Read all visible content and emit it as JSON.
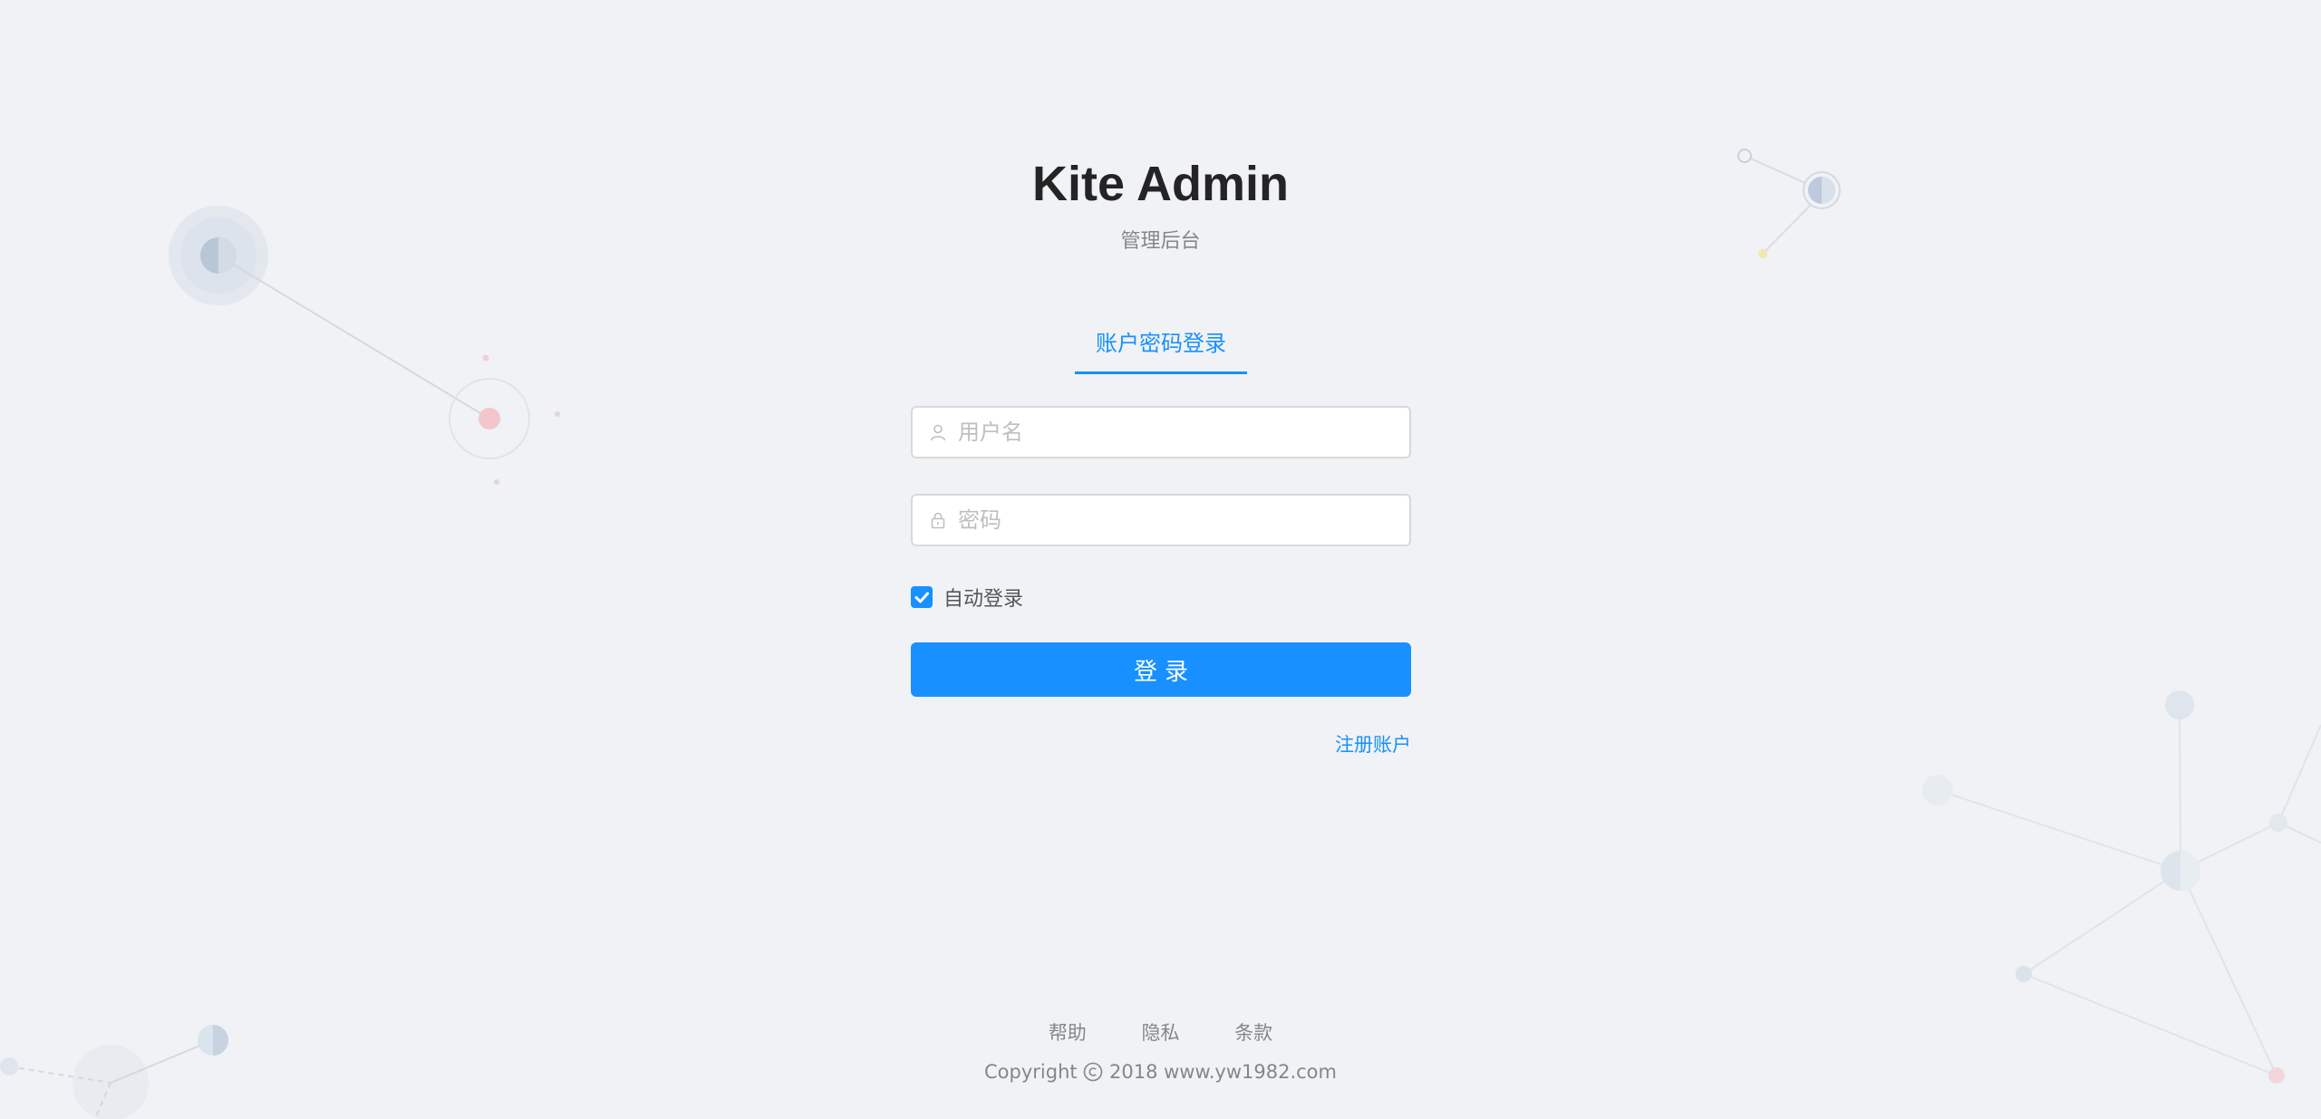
{
  "brand": {
    "title": "Kite Admin",
    "subtitle": "管理后台"
  },
  "login": {
    "tab_label": "账户密码登录",
    "username_placeholder": "用户名",
    "username_value": "",
    "password_placeholder": "密码",
    "password_value": "",
    "remember_label": "自动登录",
    "remember_checked": true,
    "submit_label": "登录",
    "register_label": "注册账户"
  },
  "footer": {
    "links": [
      "帮助",
      "隐私",
      "条款"
    ],
    "copyright_prefix": "Copyright",
    "copyright_text": "2018 www.yw1982.com"
  },
  "icons": {
    "username": "user-icon",
    "password": "lock-icon",
    "checkbox": "check-icon",
    "copyright": "copyright-icon"
  },
  "colors": {
    "background": "#f0f2f5",
    "primary": "#1890ff",
    "input_border": "#d9d9d9",
    "placeholder": "#bfbfbf"
  }
}
